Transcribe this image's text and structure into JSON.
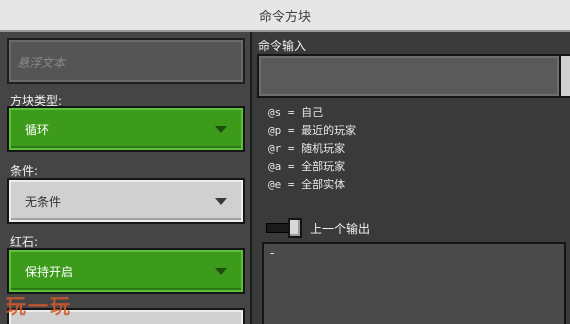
{
  "window": {
    "title": "命令方块"
  },
  "left": {
    "hover_text_placeholder": "悬浮文本",
    "block_type": {
      "label": "方块类型:",
      "value": "循环"
    },
    "condition": {
      "label": "条件:",
      "value": "无条件"
    },
    "redstone": {
      "label": "红石:",
      "value": "保持开启"
    }
  },
  "right": {
    "command_input_label": "命令输入",
    "selectors": [
      "@s = 自己",
      "@p = 最近的玩家",
      "@r = 随机玩家",
      "@a = 全部玩家",
      "@e = 全部实体"
    ],
    "previous_output_label": "上一个输出",
    "previous_output_value": "-"
  },
  "watermark": "玩一玩",
  "colors": {
    "accent_green": "#3d9b1c",
    "panel_dark": "#454545",
    "title_bar": "#e6e6e6"
  }
}
